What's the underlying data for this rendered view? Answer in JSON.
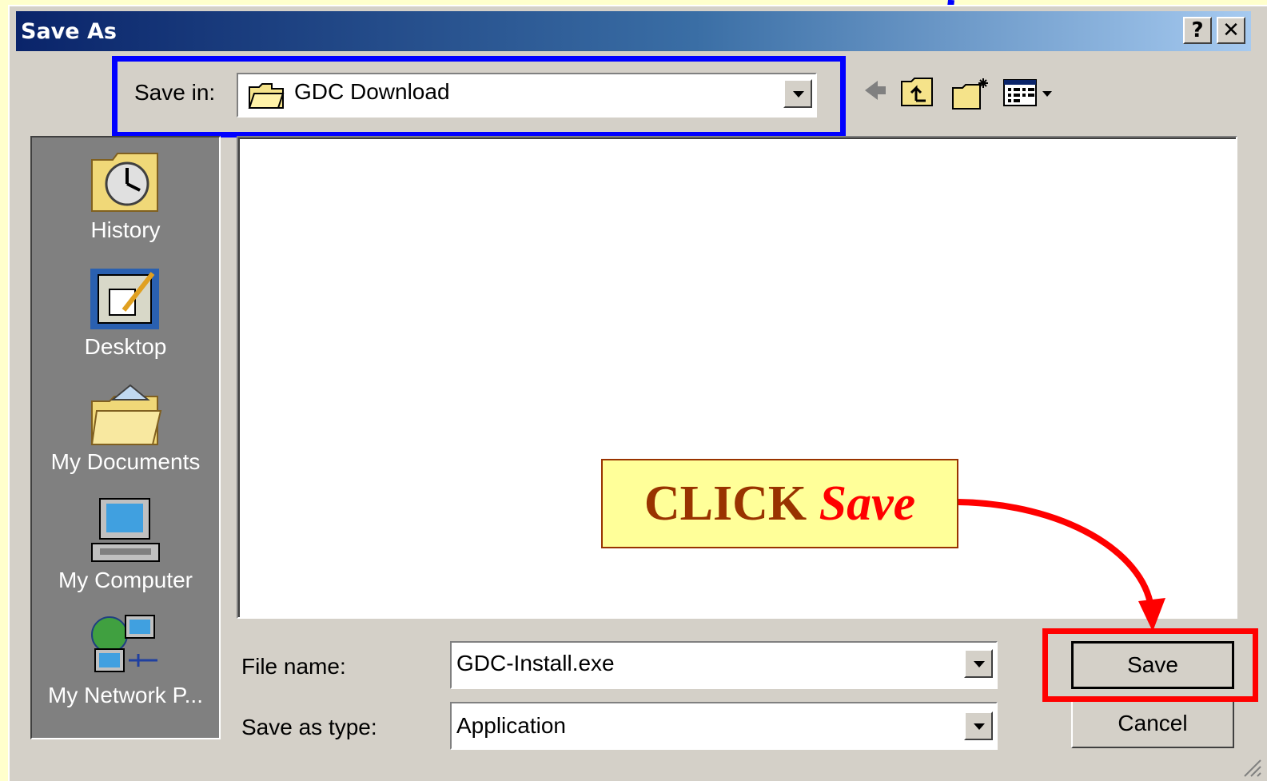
{
  "dialog": {
    "title": "Save As",
    "help_button": "?",
    "close_button": "✕"
  },
  "save_in": {
    "label": "Save in:",
    "value": "GDC Download"
  },
  "places_bar": [
    {
      "label": "History",
      "icon": "history-icon"
    },
    {
      "label": "Desktop",
      "icon": "desktop-icon"
    },
    {
      "label": "My Documents",
      "icon": "my-documents-icon"
    },
    {
      "label": "My Computer",
      "icon": "my-computer-icon"
    },
    {
      "label": "My Network P...",
      "icon": "network-places-icon"
    }
  ],
  "file_name": {
    "label": "File name:",
    "value": "GDC-Install.exe"
  },
  "save_as_type": {
    "label": "Save as type:",
    "value": "Application"
  },
  "buttons": {
    "save": "Save",
    "cancel": "Cancel"
  },
  "callout": {
    "prefix": "CLICK",
    "emphasis": "Save"
  },
  "colors": {
    "highlight_blue": "#0000ff",
    "highlight_red": "#ff0000",
    "callout_bg": "#ffff99",
    "callout_text": "#993300"
  }
}
